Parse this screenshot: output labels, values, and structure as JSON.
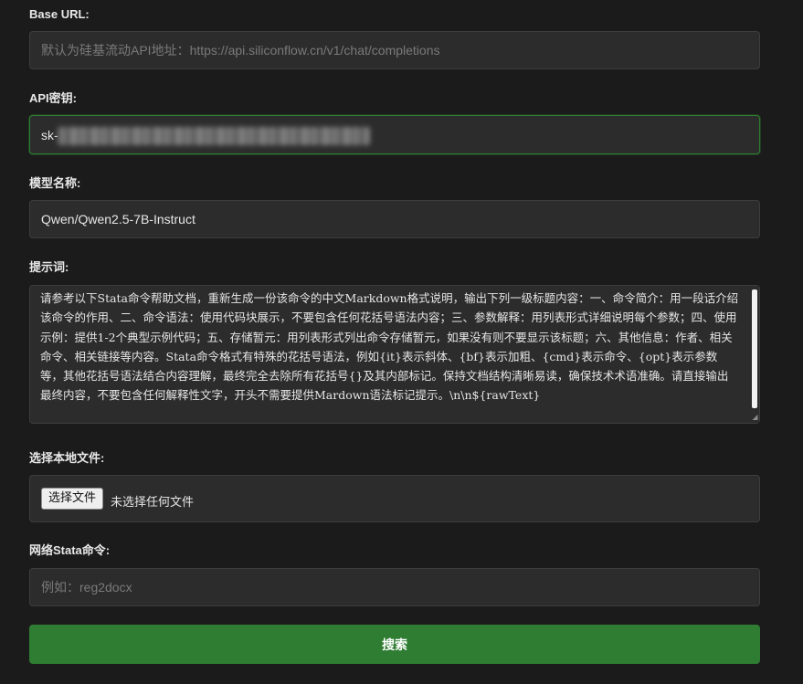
{
  "form": {
    "base_url": {
      "label": "Base URL:",
      "value": "",
      "placeholder": "默认为硅基流动API地址：https://api.siliconflow.cn/v1/chat/completions"
    },
    "api_key": {
      "label": "API密钥:",
      "value": "sk-"
    },
    "model": {
      "label": "模型名称:",
      "value": "Qwen/Qwen2.5-7B-Instruct"
    },
    "prompt": {
      "label": "提示词:",
      "value": "请参考以下Stata命令帮助文档，重新生成一份该命令的中文Markdown格式说明，输出下列一级标题内容：一、命令简介：用一段话介绍该命令的作用、二、命令语法：使用代码块展示，不要包含任何花括号语法内容；三、参数解释：用列表形式详细说明每个参数；四、使用示例：提供1-2个典型示例代码；五、存储暂元：用列表形式列出命令存储暂元，如果没有则不要显示该标题；六、其他信息：作者、相关命令、相关链接等内容。Stata命令格式有特殊的花括号语法，例如{it}表示斜体、{bf}表示加粗、{cmd}表示命令、{opt}表示参数等，其他花括号语法结合内容理解，最终完全去除所有花括号{}及其内部标记。保持文档结构清晰易读，确保技术术语准确。请直接输出最终内容，不要包含任何解释性文字，开头不需要提供Mardown语法标记提示。\\n\\n${rawText}"
    },
    "local_file": {
      "label": "选择本地文件:",
      "button_label": "选择文件",
      "status": "未选择任何文件"
    },
    "network_command": {
      "label": "网络Stata命令:",
      "value": "",
      "placeholder": "例如：reg2docx"
    },
    "search_label": "搜索"
  },
  "colors": {
    "background": "#1b1b1b",
    "field_background": "#2c2c2c",
    "accent_green": "#2e7d32"
  }
}
